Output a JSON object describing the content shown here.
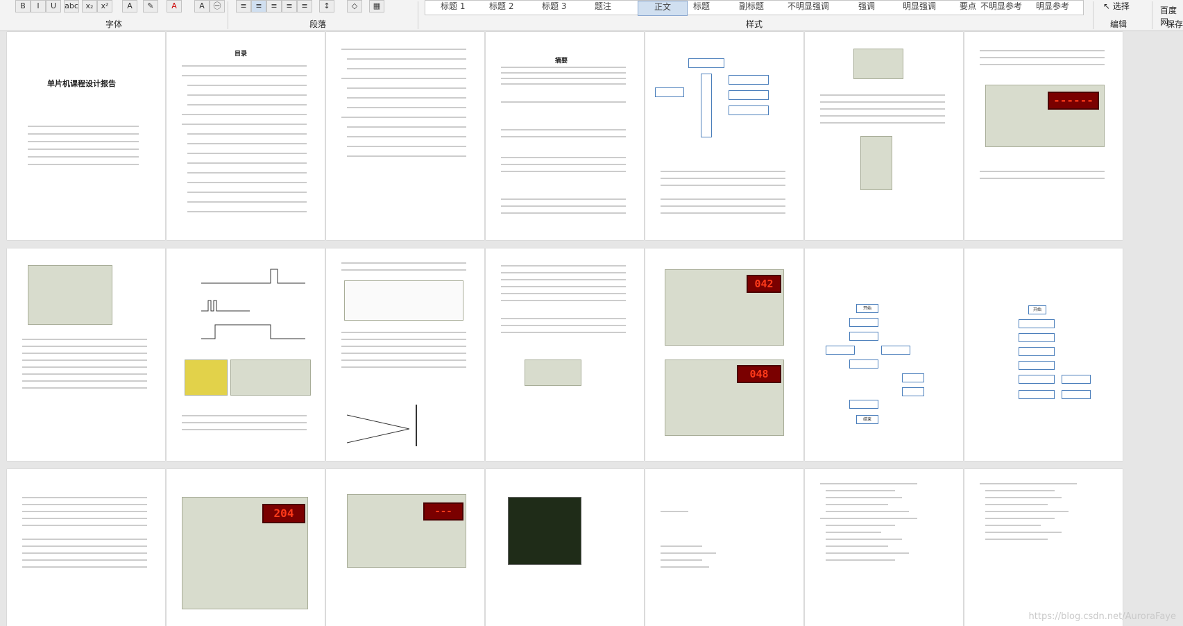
{
  "ribbon": {
    "groups": [
      "字体",
      "段落",
      "样式",
      "编辑"
    ],
    "styles": [
      "标题 1",
      "标题 2",
      "标题 3",
      "题注",
      "正文",
      "标题",
      "副标题",
      "不明显强调",
      "强调",
      "明显强调",
      "要点",
      "不明显参考",
      "明显参考"
    ],
    "active_style": "正文",
    "select_label": "选择",
    "right_labels": [
      "百度网",
      "保存"
    ]
  },
  "pages": {
    "cover_title": "单片机课程设计报告",
    "toc_title": "目录",
    "abstract_title": "摘要",
    "flow_start": "开始",
    "flow_end": "结束",
    "seg_values": [
      "042",
      "048",
      "204",
      "---",
      "------"
    ]
  },
  "watermark": "https://blog.csdn.net/AuroraFaye"
}
